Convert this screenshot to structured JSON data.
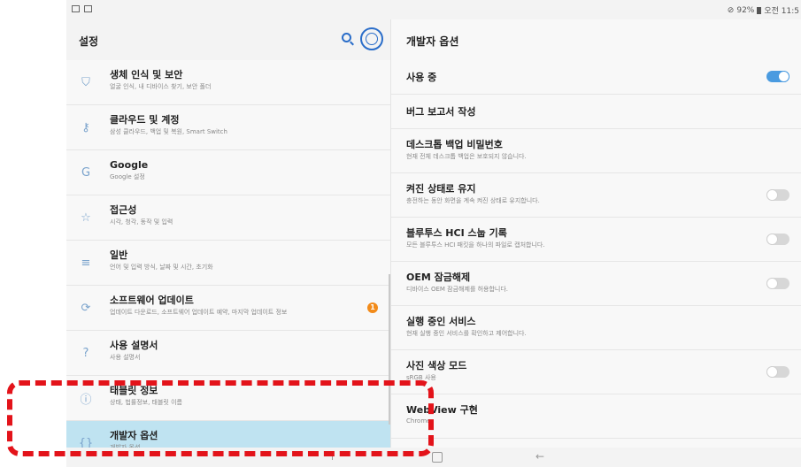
{
  "status": {
    "battery": "92%",
    "time": "오전 11:5"
  },
  "header": {
    "title": "설정"
  },
  "left_items": [
    {
      "title": "생체 인식 및 보안",
      "sub": "얼굴 인식, 내 디바이스 찾기, 보안 폴더",
      "icon": "shield-icon"
    },
    {
      "title": "클라우드 및 계정",
      "sub": "삼성 클라우드, 백업 및 복원, Smart Switch",
      "icon": "key-icon"
    },
    {
      "title": "Google",
      "sub": "Google 설정",
      "icon": "google-icon"
    },
    {
      "title": "접근성",
      "sub": "시각, 청각, 동작 및 입력",
      "icon": "accessibility-icon"
    },
    {
      "title": "일반",
      "sub": "언어 및 입력 방식, 날짜 및 시간, 초기화",
      "icon": "sliders-icon"
    },
    {
      "title": "소프트웨어 업데이트",
      "sub": "업데이트 다운로드, 소프트웨어 업데이트 예약, 마지막 업데이트 정보",
      "icon": "update-icon",
      "badge": "1"
    },
    {
      "title": "사용 설명서",
      "sub": "사용 설명서",
      "icon": "manual-icon"
    },
    {
      "title": "태블릿 정보",
      "sub": "상태, 법률정보, 태블릿 이름",
      "icon": "info-icon"
    },
    {
      "title": "개발자 옵션",
      "sub": "개발자 옵션",
      "icon": "braces-icon",
      "selected": true
    }
  ],
  "right": {
    "title": "개발자 옵션",
    "items": [
      {
        "title": "사용 중",
        "sub": "",
        "toggle": "on"
      },
      {
        "title": "버그 보고서 작성",
        "sub": "",
        "toggle": "none"
      },
      {
        "title": "데스크톱 백업 비밀번호",
        "sub": "현재 전체 데스크톱 백업은 보호되지 않습니다.",
        "toggle": "none"
      },
      {
        "title": "켜진 상태로 유지",
        "sub": "충전하는 동안 화면을 계속 켜진 상태로 유지합니다.",
        "toggle": "off"
      },
      {
        "title": "블루투스 HCI 스눕 기록",
        "sub": "모든 블루투스 HCI 패킷을 하나의 파일로 캡처합니다.",
        "toggle": "off"
      },
      {
        "title": "OEM 잠금해제",
        "sub": "디바이스 OEM 잠금해제를 허용합니다.",
        "toggle": "off"
      },
      {
        "title": "실행 중인 서비스",
        "sub": "현재 실행 중인 서비스를 확인하고 제어합니다.",
        "toggle": "none"
      },
      {
        "title": "사진 색상 모드",
        "sub": "sRGB 사용",
        "toggle": "off"
      },
      {
        "title": "WebView 구현",
        "sub": "Chrome",
        "toggle": "none"
      }
    ]
  },
  "colors": {
    "accent": "#2a6dc9",
    "selected_bg": "#bfe3f1",
    "badge": "#f28b1a",
    "highlight": "#e3131a"
  }
}
